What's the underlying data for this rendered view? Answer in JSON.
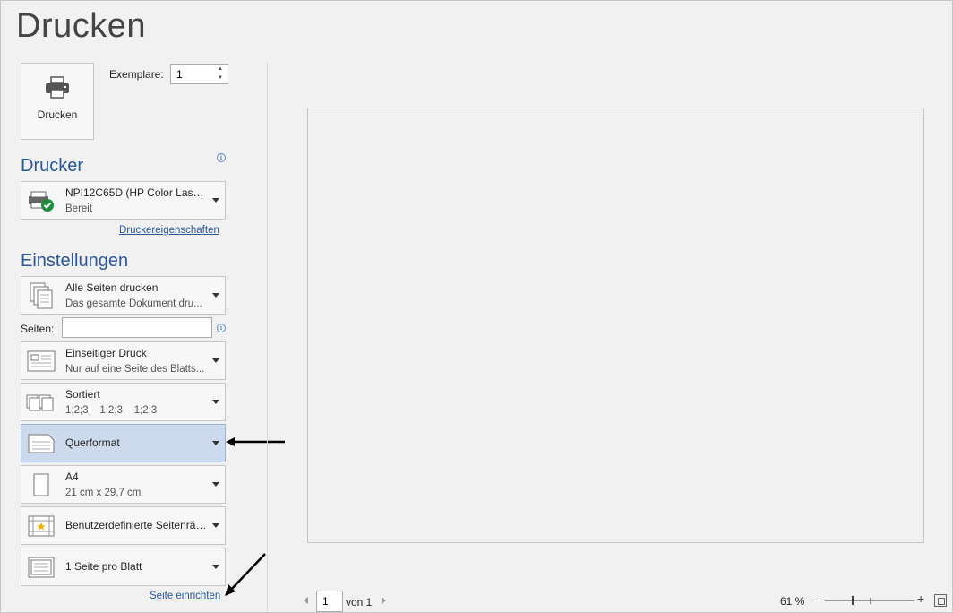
{
  "page": {
    "title": "Drucken"
  },
  "print_button": {
    "label": "Drucken"
  },
  "copies": {
    "label": "Exemplare:",
    "value": "1"
  },
  "printer_section": {
    "heading": "Drucker",
    "printer_name": "NPI12C65D (HP Color LaserJ...",
    "printer_status": "Bereit",
    "properties_link": "Druckereigenschaften"
  },
  "settings_section": {
    "heading": "Einstellungen",
    "pages_label": "Seiten:",
    "page_setup_link": "Seite einrichten",
    "items": [
      {
        "line1": "Alle Seiten drucken",
        "line2": "Das gesamte Dokument dru...",
        "icon": "pages-icon"
      },
      {
        "line1": "Einseitiger Druck",
        "line2": "Nur auf eine Seite des Blatts...",
        "icon": "one-sided-icon"
      },
      {
        "line1": "Sortiert",
        "line2": "1;2;3    1;2;3    1;2;3",
        "icon": "collated-icon"
      },
      {
        "line1": "Querformat",
        "icon": "landscape-icon"
      },
      {
        "line1": "A4",
        "line2": "21 cm x 29,7 cm",
        "icon": "paper-size-icon"
      },
      {
        "line1": "Benutzerdefinierte Seitenrän...",
        "icon": "margins-icon"
      },
      {
        "line1": "1 Seite pro Blatt",
        "icon": "pages-per-sheet-icon"
      }
    ]
  },
  "preview_nav": {
    "current_page": "1",
    "of_label": "von 1"
  },
  "zoom": {
    "label": "61 %"
  },
  "colors": {
    "accent": "#2b579a",
    "active": "#cdd9ec",
    "background": "#f1f1f1"
  }
}
